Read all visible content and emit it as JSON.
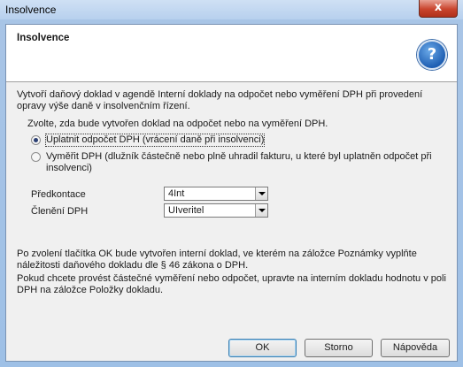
{
  "window": {
    "title": "Insolvence",
    "close_glyph": "x"
  },
  "header": {
    "title": "Insolvence",
    "icon": "help-icon"
  },
  "description": "Vytvoří daňový doklad v agendě Interní doklady na odpočet nebo vyměření DPH při provedení opravy výše daně v insolvenčním řízení.",
  "prompt": "Zvolte, zda bude vytvořen doklad na odpočet nebo na vyměření DPH.",
  "options": [
    {
      "label": "Uplatnit odpočet DPH (vrácení daně při insolvenci)",
      "checked": true
    },
    {
      "label": "Vyměřit DPH (dlužník částečně nebo plně uhradil fakturu, u které byl uplatněn odpočet při insolvenci)",
      "checked": false
    }
  ],
  "fields": {
    "predkontace": {
      "label": "Předkontace",
      "value": "4Int"
    },
    "cleneni": {
      "label": "Členění DPH",
      "value": "UIveritel"
    }
  },
  "notes": {
    "ok_info": "Po zvolení tlačítka OK bude vytvořen interní doklad, ve kterém na záložce Poznámky vyplňte náležitosti daňového dokladu dle § 46 zákona o DPH.",
    "partial_info": "Pokud chcete provést částečné vyměření nebo odpočet, upravte na interním dokladu hodnotu v poli DPH na záložce Položky dokladu."
  },
  "buttons": {
    "ok": "OK",
    "cancel": "Storno",
    "help": "Nápověda"
  }
}
